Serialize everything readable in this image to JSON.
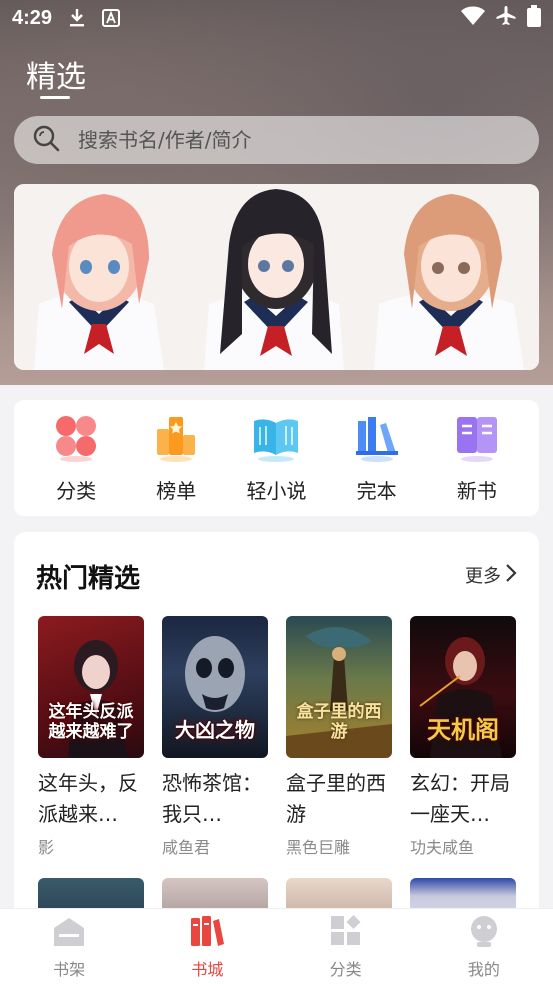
{
  "status_bar": {
    "time": "4:29"
  },
  "header": {
    "title": "精选"
  },
  "search": {
    "placeholder": "搜索书名/作者/简介"
  },
  "categories": [
    {
      "label": "分类",
      "icon": "grid-petal-icon"
    },
    {
      "label": "榜单",
      "icon": "ranking-star-icon"
    },
    {
      "label": "轻小说",
      "icon": "open-book-icon"
    },
    {
      "label": "完本",
      "icon": "books-shelf-icon"
    },
    {
      "label": "新书",
      "icon": "new-book-icon"
    }
  ],
  "hot": {
    "title": "热门精选",
    "more": "更多",
    "books": [
      {
        "name": "这年头，反派越来…",
        "author": "影",
        "cover_text": "这年头反派越来越难了"
      },
      {
        "name": "恐怖茶馆：我只…",
        "author": "咸鱼君",
        "cover_text": "大凶之物"
      },
      {
        "name": "盒子里的西游",
        "author": "黑色巨雕",
        "cover_text": "盒子里的西游"
      },
      {
        "name": "玄幻：开局一座天…",
        "author": "功夫咸鱼",
        "cover_text": "天机阁"
      }
    ]
  },
  "bottom_nav": [
    {
      "label": "书架",
      "icon": "bookshelf-icon",
      "active": false
    },
    {
      "label": "书城",
      "icon": "bookstore-icon",
      "active": true
    },
    {
      "label": "分类",
      "icon": "category-icon",
      "active": false
    },
    {
      "label": "我的",
      "icon": "profile-icon",
      "active": false
    }
  ],
  "colors": {
    "accent": "#e8463f",
    "background": "#f3f3f5"
  }
}
